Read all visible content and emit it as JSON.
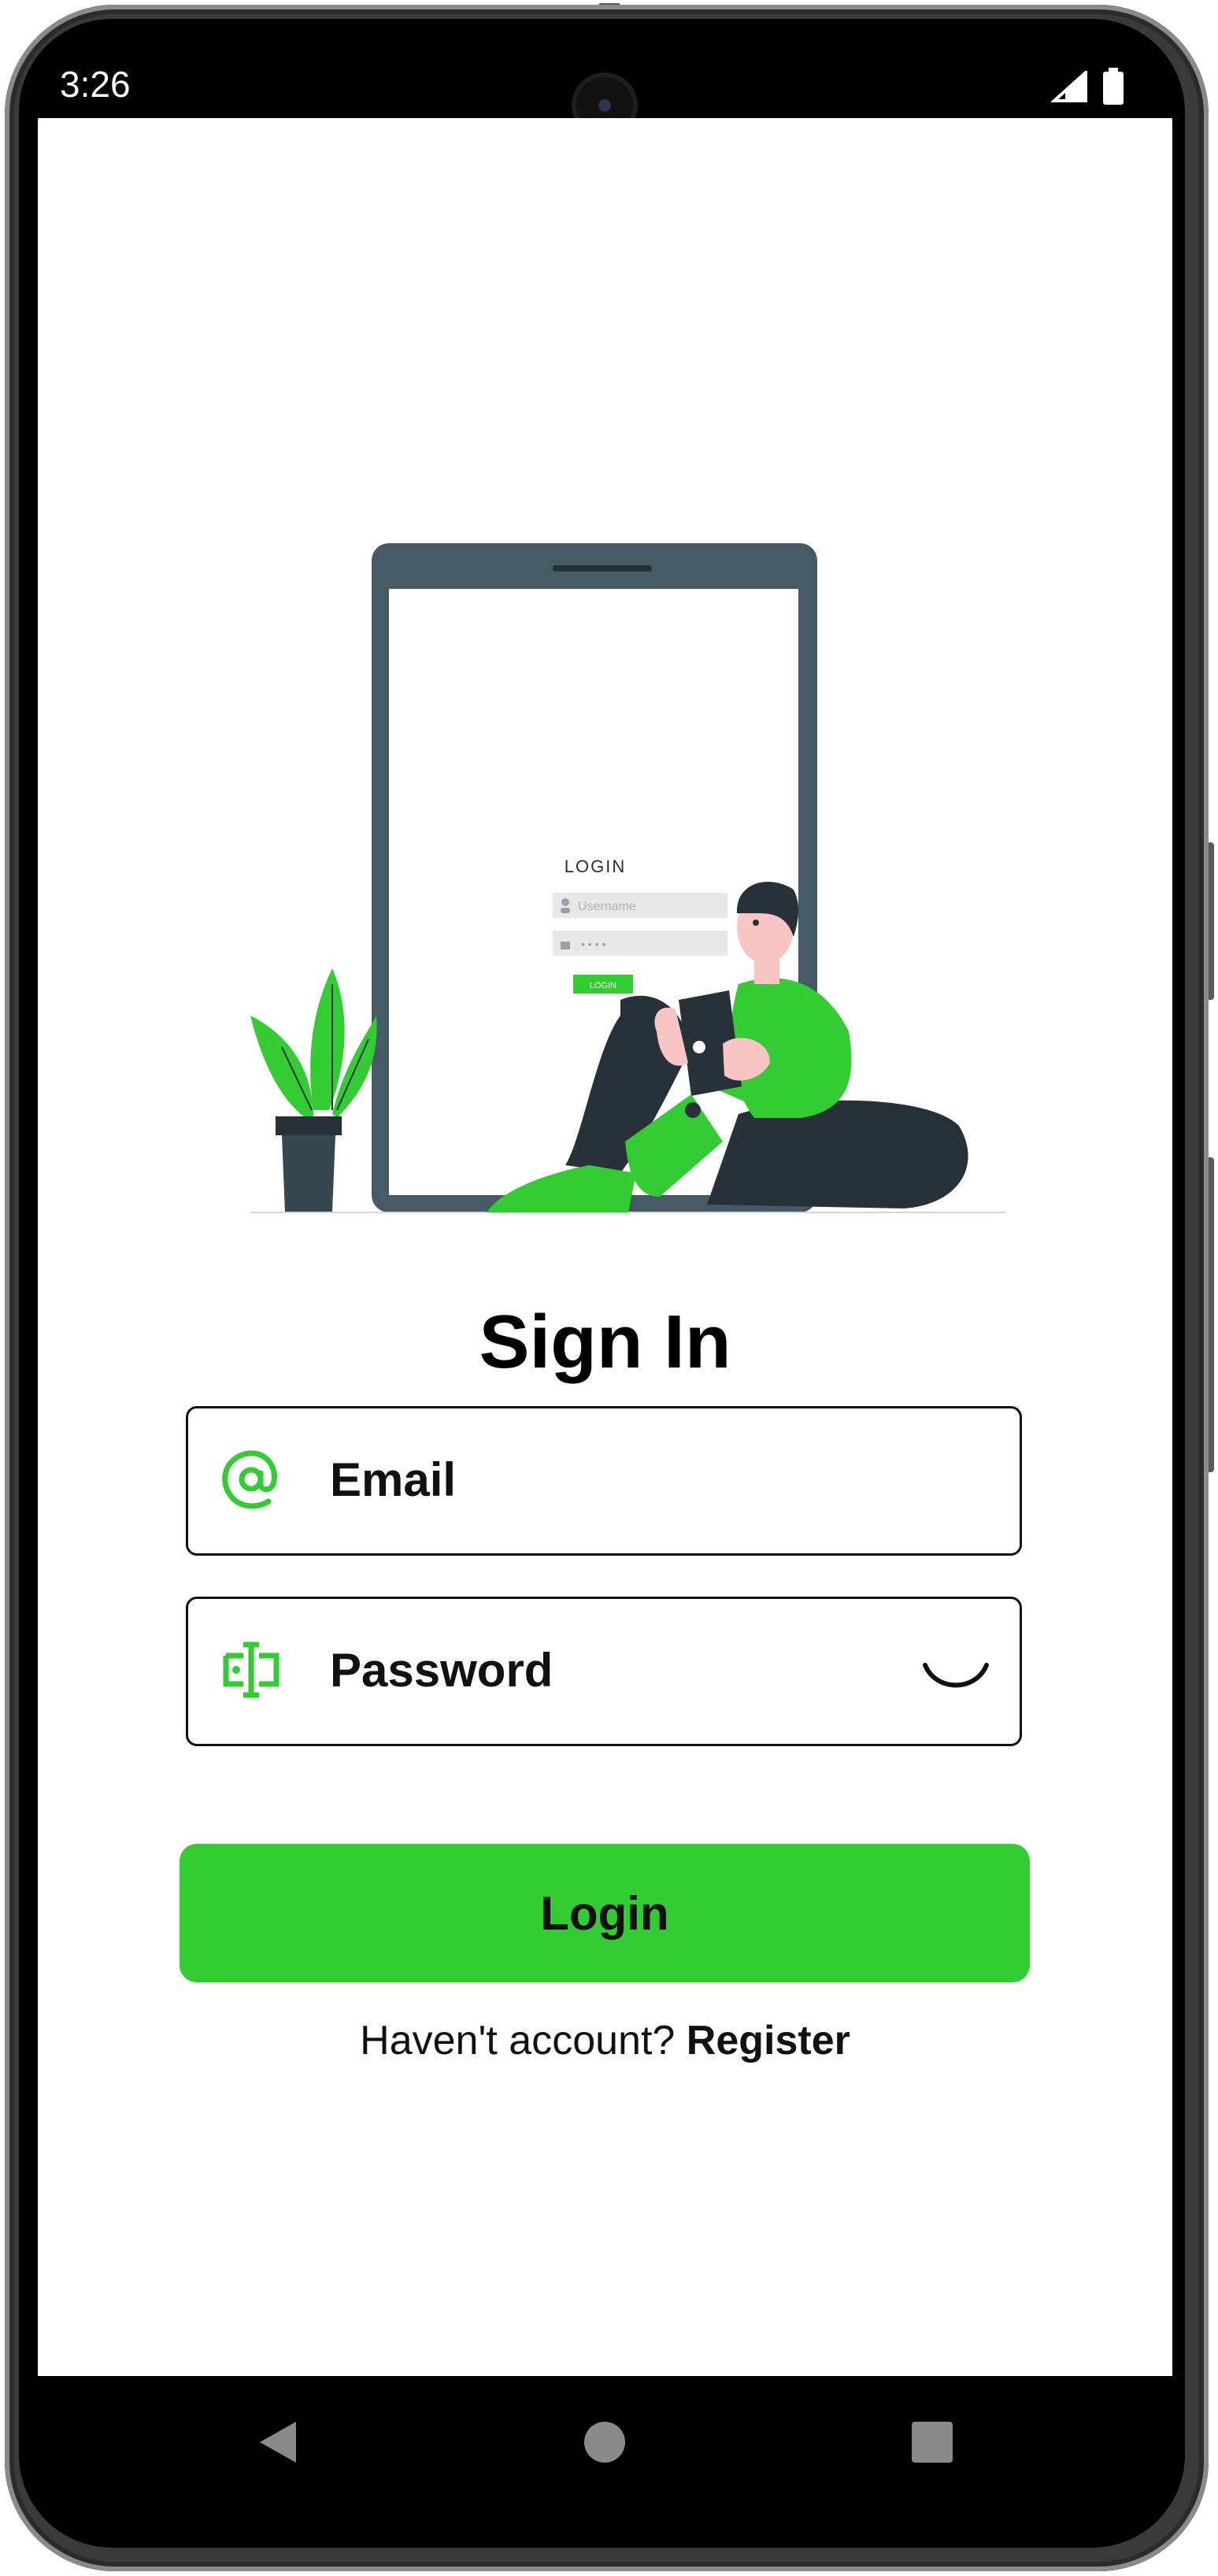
{
  "status_bar": {
    "time": "3:26"
  },
  "illustration": {
    "screen_title": "LOGIN",
    "username_placeholder": "Username",
    "password_mask": "• • • •",
    "button_label": "LOGIN"
  },
  "page": {
    "title": "Sign In"
  },
  "email_field": {
    "label": "Email",
    "icon": "at-sign-icon"
  },
  "password_field": {
    "label": "Password",
    "icon": "password-cursor-icon"
  },
  "login_button": {
    "label": "Login"
  },
  "register": {
    "prompt": "Haven't account?",
    "link": "Register"
  },
  "colors": {
    "accent": "#33cc33",
    "dark": "#455a64",
    "text": "#111111"
  }
}
